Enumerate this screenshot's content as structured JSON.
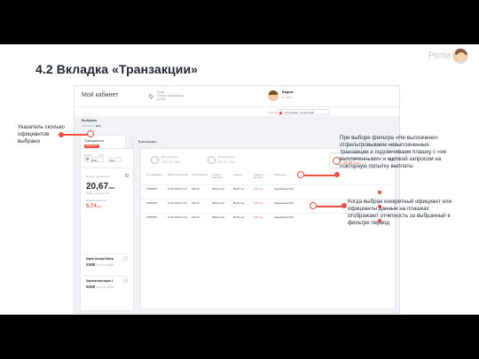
{
  "slide": {
    "roles_label": "Роли",
    "title": "4.2 Вкладка «Транзакции»"
  },
  "mock": {
    "cabinet_title": "Мой кабинет",
    "address_lines": [
      "Суши",
      "г.Томск, Вокзальная",
      "ул 000"
    ],
    "user_name": "Вадим",
    "user_role": "И. 1235",
    "period_label": "Период",
    "period_value": "13.02.2018 - 21.02.2018",
    "filter_title": "Выбрано",
    "filter_sub_label": "Официант:",
    "filter_sub_value": "Все",
    "tab_waiters": "Официанты",
    "tab_waiters_badge": "Выбрано 2",
    "tab_transactions": "Транзакции",
    "select_caption_1": "Кассир",
    "select_caption_2": "Стол",
    "select_value_1": "ВСЕ",
    "select_value_2": "Все",
    "balance_label": "Баланс на сегодня",
    "balance_value": "20,67",
    "balance_unit": "тыс",
    "commission": "Комм. сервиса: 2%",
    "nonpaid_label": "Невыплаченные",
    "nonpaid_value": "5,74",
    "nonpaid_unit": "тыс",
    "banks": [
      {
        "name": "Карта Альфа банка",
        "num_prefix": "5368",
        "num_masked": "•••• •••• 4455"
      },
      {
        "name": "Зарплатная карта 1",
        "num_prefix": "5368",
        "num_masked": "•••• •••• 4433"
      }
    ],
    "summaries": [
      {
        "label": "Все операции",
        "value": "344,45 тыс."
      },
      {
        "label": "Выплаченные",
        "value": "52,31 тыс."
      },
      {
        "label": "Не выплачено",
        "value": "23,45 тыс."
      }
    ],
    "table_headers": [
      "№ транзакции",
      "Время транзакции",
      "№ терминала",
      "Сумма с чаевыми",
      "Чаевые",
      "Чаевые к выплате",
      "Официант"
    ],
    "rows": [
      {
        "id": "67569557",
        "time": "21.02.2018 21:10",
        "terminal": "232-00",
        "sum": "489,00 тыс",
        "tips": "89,00 тыс",
        "tips_pay": "3,87 тыс.",
        "waiter": "Кудрявцева Ю.В."
      },
      {
        "id": "67569557",
        "time": "21.02.2018 21:10",
        "terminal": "232-00",
        "sum": "489,00 тыс",
        "tips": "89,00 тыс",
        "tips_pay": "3,87 тыс.",
        "waiter": "Кудрявцева Ю.В."
      },
      {
        "id": "67569557",
        "time": "21.02.2018 21:10",
        "terminal": "232-00",
        "sum": "489,00 тыс",
        "tips": "89,00 тыс",
        "tips_pay": "3,87 тыс.",
        "waiter": "Кудрявцева Ю.В."
      }
    ]
  },
  "callouts": {
    "left": "Указатель сколько официантов выбрано",
    "right_top": "При выборе фильтра «Не выплачено» отфильтровываем невыплаченные транзакции и подсвечиваем плашку с «не выплаченными» и кнопкой запросом на повторную попытку выплаты",
    "right_bottom": "Когда выбран конкретный официант или официанты данные на плашках отображают отчетность за выбранный в фильтре период"
  },
  "colors": {
    "accent": "#f04e3e",
    "text": "#1e2530",
    "frame": "#000000"
  }
}
